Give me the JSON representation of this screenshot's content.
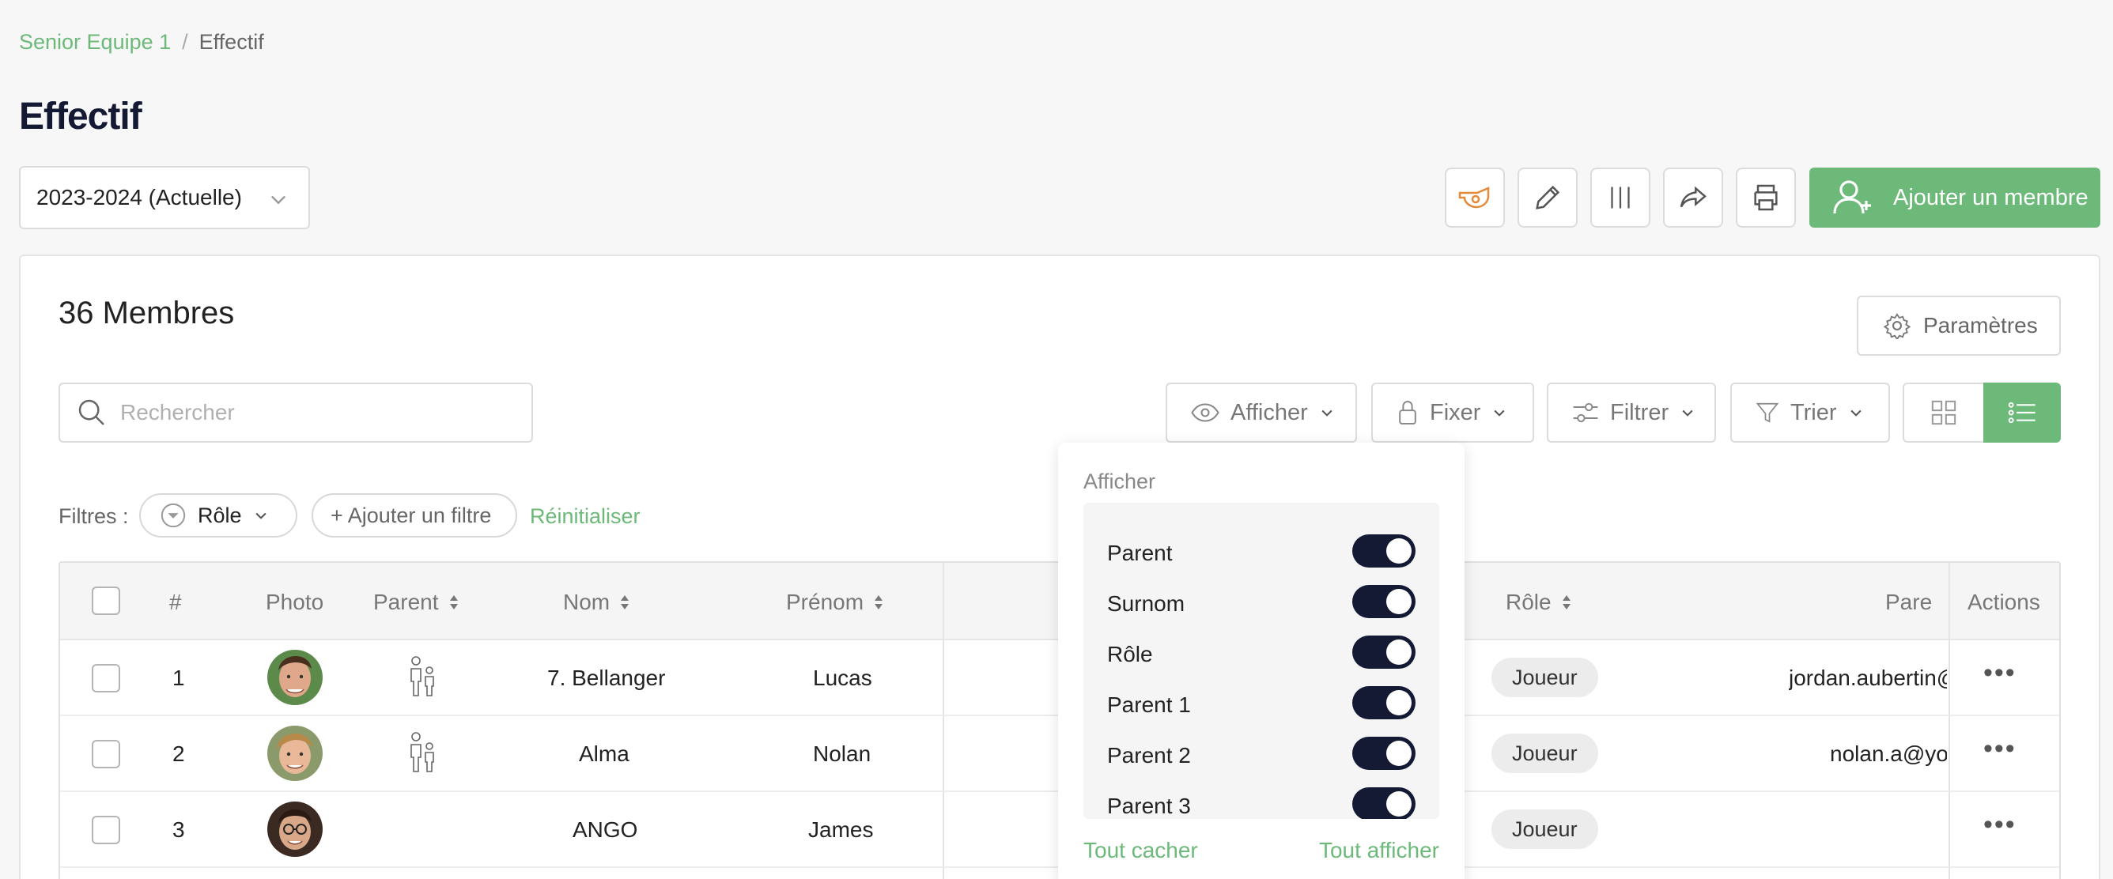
{
  "breadcrumb": {
    "parent": "Senior Equipe 1",
    "separator": "/",
    "current": "Effectif"
  },
  "page_title": "Effectif",
  "season_select": {
    "value": "2023-2024 (Actuelle)"
  },
  "toolbar": {
    "add_member_label": "Ajouter un membre"
  },
  "members_count": "36 Membres",
  "params_label": "Paramètres",
  "search": {
    "placeholder": "Rechercher"
  },
  "filter_bar": {
    "afficher": "Afficher",
    "fixer": "Fixer",
    "filtrer": "Filtrer",
    "trier": "Trier"
  },
  "filters": {
    "label": "Filtres :",
    "role_chip": "Rôle",
    "add_filter": "+ Ajouter un filtre",
    "reset": "Réinitialiser"
  },
  "table": {
    "columns": {
      "number": "#",
      "photo": "Photo",
      "parent": "Parent",
      "nom": "Nom",
      "prenom": "Prénom",
      "role": "Rôle",
      "parent1": "Pare",
      "actions": "Actions"
    },
    "rows": [
      {
        "num": "1",
        "nom": "7. Bellanger",
        "prenom": "Lucas",
        "role": "Joueur",
        "parent_email": "jordan.aubertin@",
        "has_parent": true
      },
      {
        "num": "2",
        "nom": "Alma",
        "prenom": "Nolan",
        "role": "Joueur",
        "parent_email": "nolan.a@yo",
        "has_parent": true
      },
      {
        "num": "3",
        "nom": "ANGO",
        "prenom": "James",
        "role": "Joueur",
        "parent_email": "",
        "has_parent": false
      }
    ]
  },
  "display_dropdown": {
    "title": "Afficher",
    "items": [
      "Parent",
      "Surnom",
      "Rôle",
      "Parent 1",
      "Parent 2",
      "Parent 3"
    ],
    "hide_all": "Tout cacher",
    "show_all": "Tout afficher"
  },
  "colors": {
    "accent": "#6cb97a",
    "dark": "#141a33",
    "whistle": "#e5893a"
  }
}
